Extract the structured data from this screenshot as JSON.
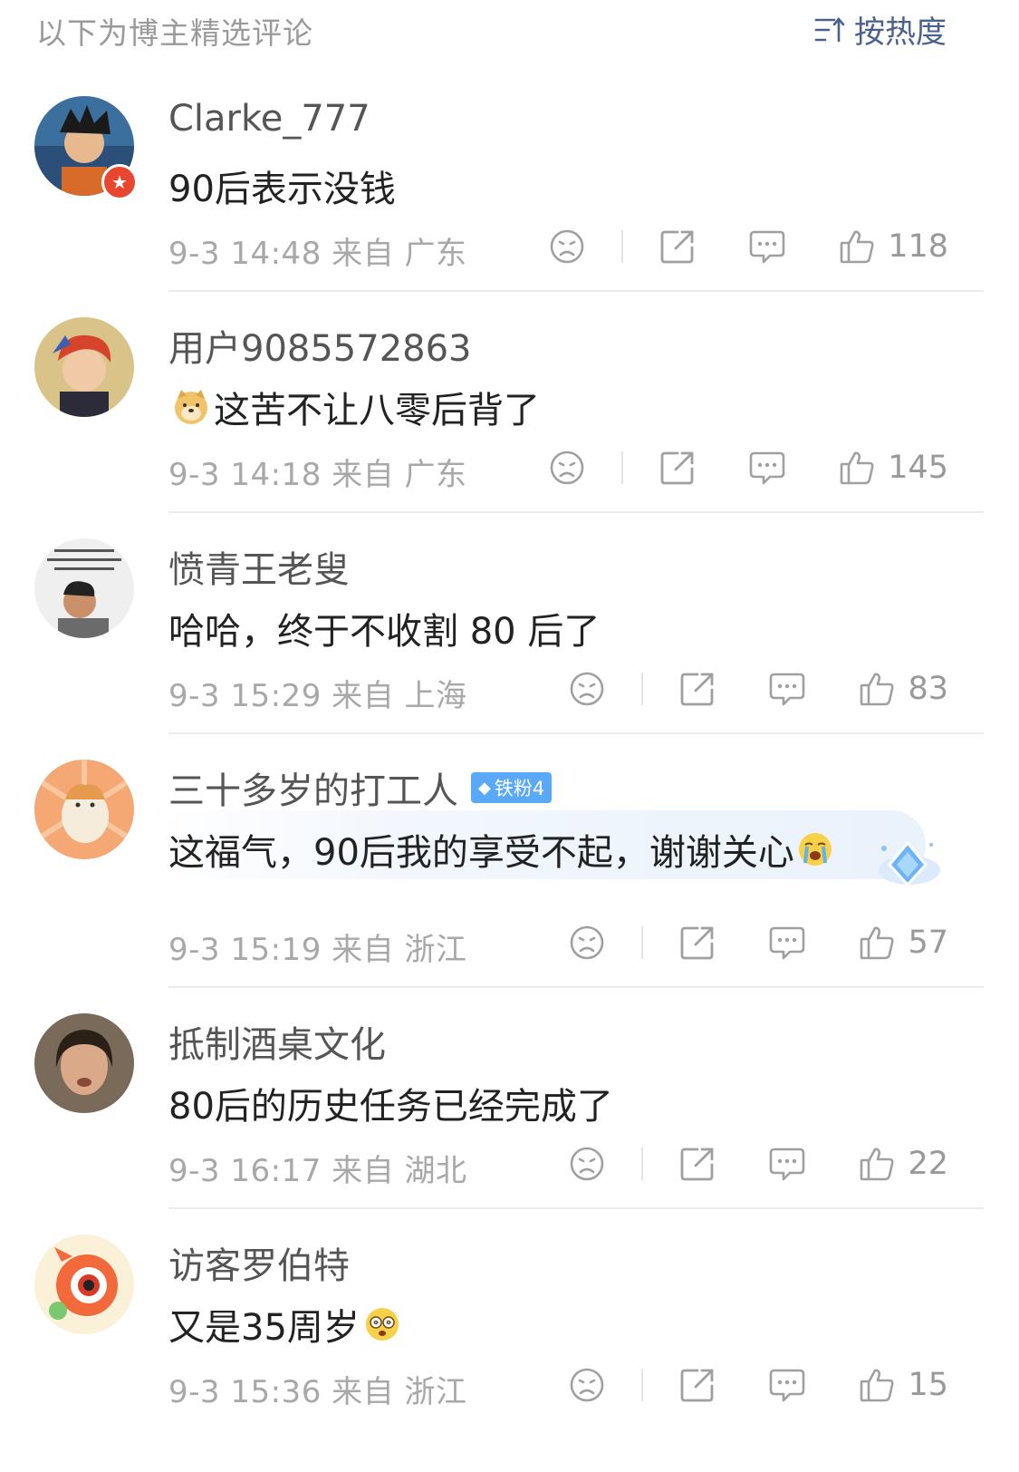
{
  "header": {
    "title": "以下为博主精选评论",
    "sort_label": "按热度"
  },
  "comments": [
    {
      "user": "Clarke_777",
      "text": "90后表示没钱",
      "time": "9-3 14:48",
      "source": "来自 广东",
      "likes": "118",
      "badge": ""
    },
    {
      "user": "用户9085572863",
      "text": "这苦不让八零后背了",
      "time": "9-3 14:18",
      "source": "来自 广东",
      "likes": "145",
      "badge": ""
    },
    {
      "user": "愤青王老叟",
      "text": "哈哈，终于不收割 80 后了",
      "time": "9-3 15:29",
      "source": "来自 上海",
      "likes": "83",
      "badge": ""
    },
    {
      "user": "三十多岁的打工人",
      "text": "这福气，90后我的享受不起，谢谢关心",
      "time": "9-3 15:19",
      "source": "来自 浙江",
      "likes": "57",
      "badge": "铁粉4"
    },
    {
      "user": "抵制酒桌文化",
      "text": "80后的历史任务已经完成了",
      "time": "9-3 16:17",
      "source": "来自 湖北",
      "likes": "22",
      "badge": ""
    },
    {
      "user": "访客罗伯特",
      "text": "又是35周岁",
      "time": "9-3 15:36",
      "source": "来自 浙江",
      "likes": "15",
      "badge": ""
    }
  ],
  "colors": {
    "accent": "#4a6190",
    "badge": "#5aa9f8",
    "meta": "#a8a8a8"
  },
  "icons": [
    "sort-icon",
    "dislike-icon",
    "share-icon",
    "comment-icon",
    "like-icon"
  ]
}
